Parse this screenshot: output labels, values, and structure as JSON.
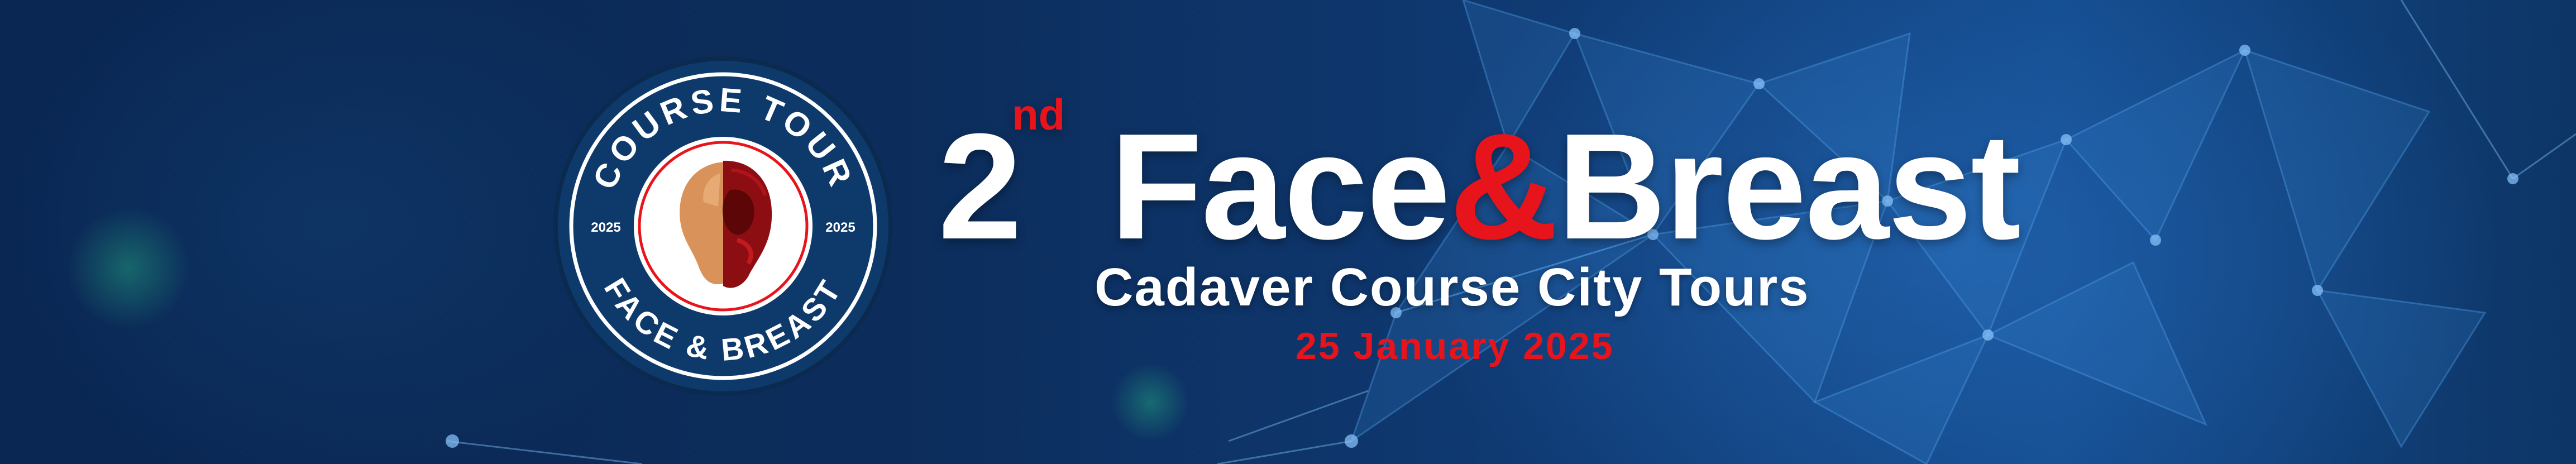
{
  "banner": {
    "ordinal_number": "2",
    "ordinal_suffix": "nd",
    "title_part1": "Face",
    "title_ampersand": "&",
    "title_part2": "Breast",
    "subtitle": "Cadaver Course City Tours",
    "date": "25 January 2025"
  },
  "seal": {
    "top_text": "COURSE TOUR",
    "bottom_text": "FACE & BREAST",
    "year_left": "2025",
    "year_right": "2025"
  },
  "colors": {
    "background": "#0b2a56",
    "accent_red": "#e8141b",
    "text_white": "#ffffff",
    "seal_navy": "#0e3a6b"
  }
}
